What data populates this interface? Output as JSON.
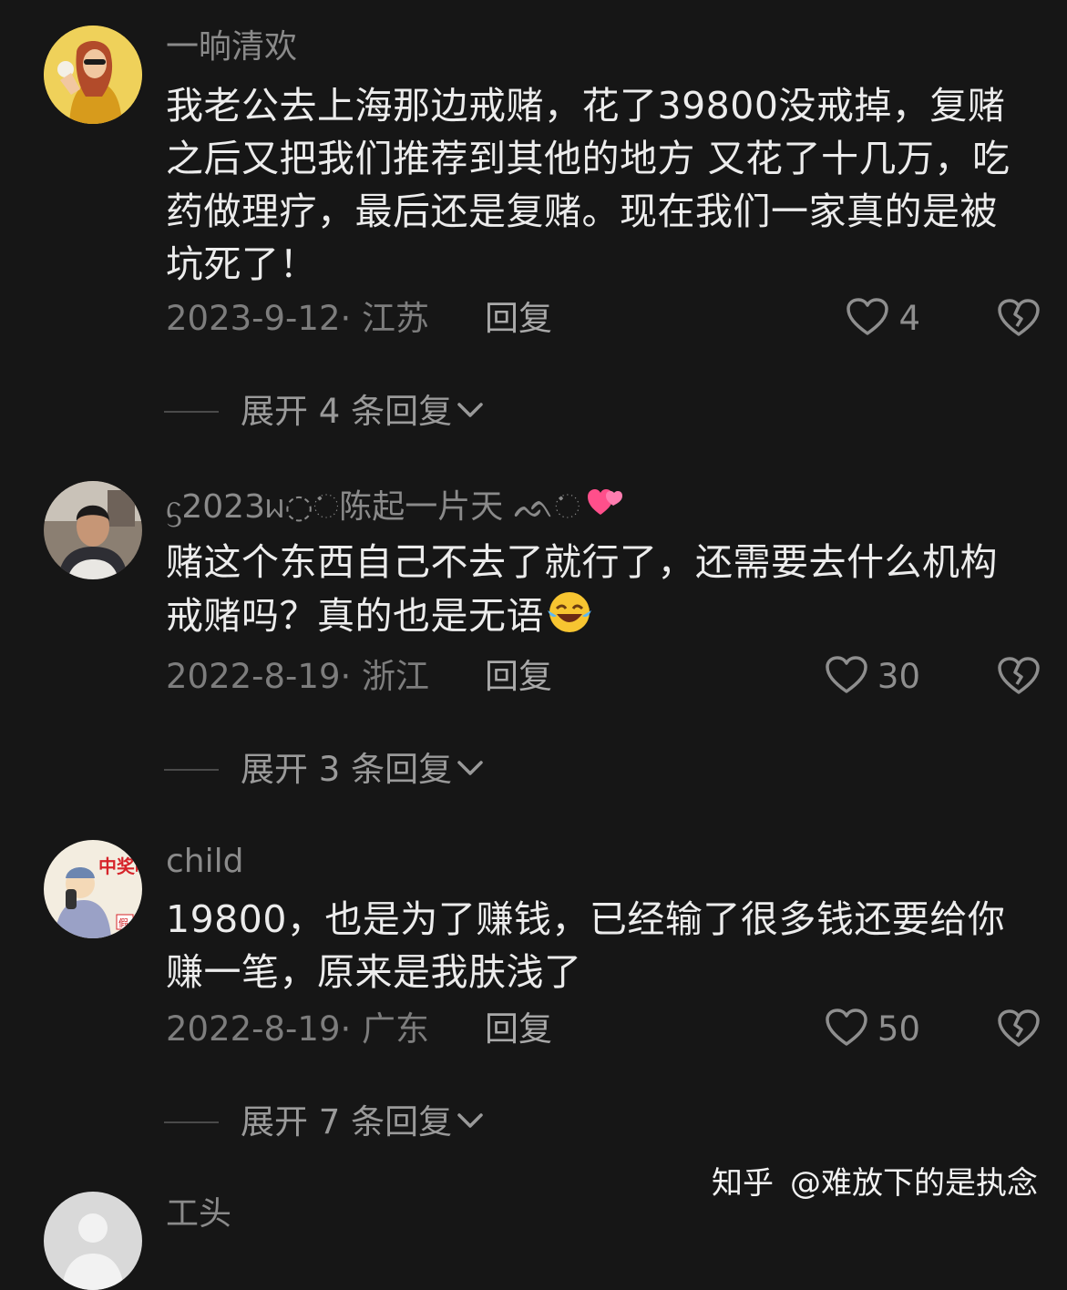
{
  "comments": [
    {
      "username": "一晌清欢",
      "text": "我老公去上海那边戒赌，花了39800没戒掉，复赌之后又把我们推荐到其他的地方 又花了十几万，吃药做理疗，最后还是复赌。现在我们一家真的是被坑死了！",
      "date": "2023-9-12· 江苏",
      "reply_label": "回复",
      "likes": "4",
      "expand_label": "展开 4 条回复"
    },
    {
      "username": "ᦓ2023ᥕ◌ᨗ陈起一片天 ᨒ◌ᨗ",
      "text": "赌这个东西自己不去了就行了，还需要去什么机构戒赌吗？真的也是无语",
      "date": "2022-8-19· 浙江",
      "reply_label": "回复",
      "likes": "30",
      "expand_label": "展开 3 条回复"
    },
    {
      "username": "child",
      "text": "19800，也是为了赚钱，已经输了很多钱还要给你赚一笔，原来是我肤浅了",
      "date": "2022-8-19· 广东",
      "reply_label": "回复",
      "likes": "50",
      "expand_label": "展开 7 条回复"
    },
    {
      "username": "工头"
    }
  ],
  "avatar3_text": "中奖啦！",
  "avatar3_tag": "假",
  "watermark": {
    "brand": "知乎",
    "author": "@难放下的是执念"
  },
  "colors": {
    "background": "#161616",
    "text": "#ececec",
    "muted": "#7d7d7d"
  },
  "icons": [
    "heart-icon",
    "broken-heart-icon",
    "chevron-down-icon",
    "sparkling-hearts-emoji",
    "laughing-tears-emoji"
  ]
}
